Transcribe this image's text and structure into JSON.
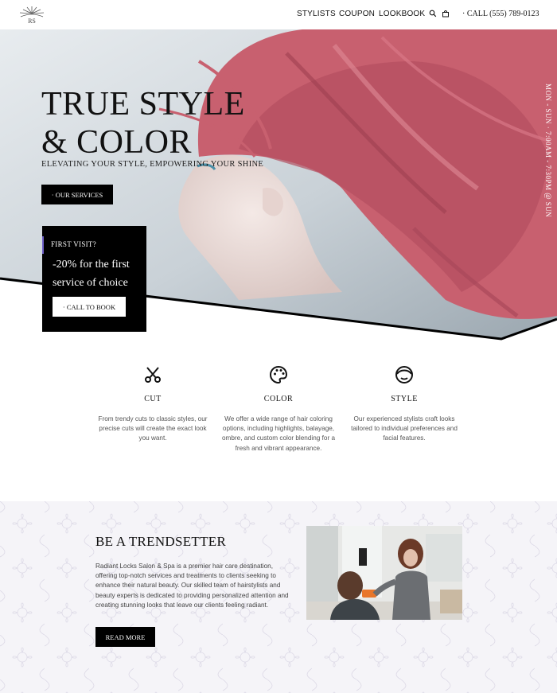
{
  "header": {
    "logo_text": "RS",
    "nav": [
      "STYLISTS",
      "COUPON",
      "LOOKBOOK"
    ],
    "phone": "· CALL (555) 789-0123"
  },
  "hero": {
    "title_line1": "TRUE STYLE",
    "title_line2": "& COLOR",
    "subtitle": "ELEVATING YOUR STYLE, EMPOWERING YOUR SHINE",
    "services_button": "· OUR SERVICES",
    "hours": "MON - SUN · 7:00AM - 7:30PM @ SUN"
  },
  "promo": {
    "label": "FIRST VISIT?",
    "text": "-20% for the first service of choice",
    "button": "· CALL TO BOOK"
  },
  "services": [
    {
      "icon": "scissors-icon",
      "title": "CUT",
      "desc": "From trendy cuts to classic styles, our precise cuts will create the exact look you want."
    },
    {
      "icon": "palette-icon",
      "title": "COLOR",
      "desc": "We offer a wide range of hair coloring options, including highlights, balayage, ombre, and custom color blending for a fresh and vibrant appearance."
    },
    {
      "icon": "face-style-icon",
      "title": "STYLE",
      "desc": "Our experienced stylists craft looks tailored to individual preferences and facial features."
    }
  ],
  "trendsetter": {
    "title": "BE A TRENDSETTER",
    "text": "Radiant Locks Salon & Spa is a premier hair care destination, offering top-notch services and treatments to clients seeking to enhance their natural beauty. Our skilled team of hairstylists and beauty experts is dedicated to providing personalized attention and creating stunning looks that leave our clients feeling radiant.",
    "button": "READ MORE"
  },
  "colors": {
    "hair": "#c8606f",
    "accent": "#6e60c8",
    "dark": "#000000"
  }
}
